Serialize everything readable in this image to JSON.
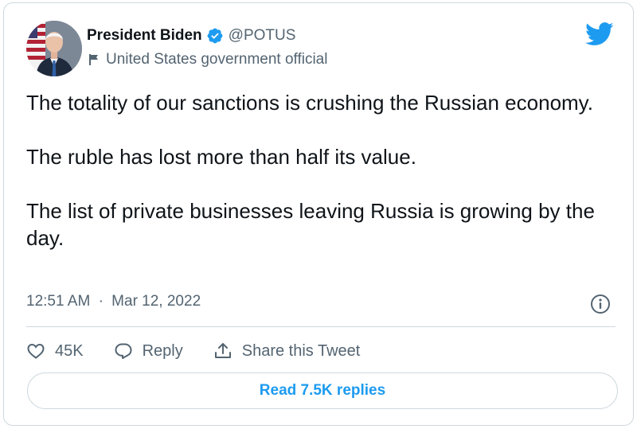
{
  "author": {
    "display_name": "President Biden",
    "handle": "@POTUS",
    "label": "United States government official",
    "verified": true
  },
  "tweet": {
    "paragraphs": [
      "The totality of our sanctions is crushing the Russian economy.",
      "The ruble has lost more than half its value.",
      "The list of private businesses leaving Russia is growing by the day."
    ],
    "time": "12:51 AM",
    "separator": "·",
    "date": "Mar 12, 2022"
  },
  "actions": {
    "like_count": "45K",
    "reply_label": "Reply",
    "share_label": "Share this Tweet"
  },
  "read_replies_label": "Read 7.5K replies",
  "colors": {
    "brand_blue": "#1d9bf0",
    "text_primary": "#0f1419",
    "text_secondary": "#536471",
    "border": "#cfd9de"
  },
  "icons": [
    "avatar-photo",
    "verified-badge-icon",
    "flag-icon",
    "twitter-bird-icon",
    "info-icon",
    "heart-icon",
    "reply-icon",
    "share-icon"
  ]
}
